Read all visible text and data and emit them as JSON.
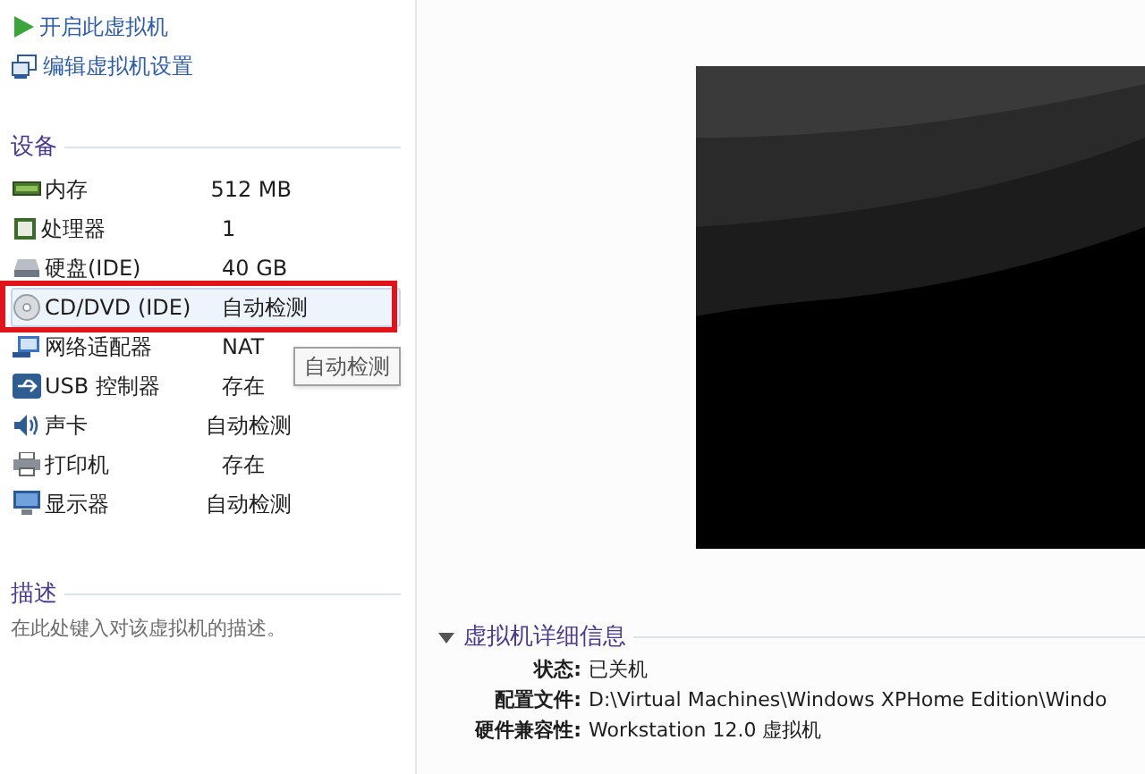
{
  "actions": [
    {
      "kind": "play",
      "label": "开启此虚拟机"
    },
    {
      "kind": "edit",
      "label": "编辑虚拟机设置"
    }
  ],
  "devices_section": {
    "title": "设备",
    "items": [
      {
        "kind": "memory",
        "name": "内存",
        "value": "512 MB",
        "selected": false
      },
      {
        "kind": "cpu",
        "name": "处理器",
        "value": "1",
        "selected": false
      },
      {
        "kind": "disk",
        "name": "硬盘(IDE)",
        "value": "40 GB",
        "selected": false
      },
      {
        "kind": "cd",
        "name": "CD/DVD (IDE)",
        "value": "自动检测",
        "selected": true
      },
      {
        "kind": "network",
        "name": "网络适配器",
        "value": "NAT",
        "selected": false
      },
      {
        "kind": "usb",
        "name": "USB 控制器",
        "value": "存在",
        "selected": false
      },
      {
        "kind": "sound",
        "name": "声卡",
        "value": "自动检测",
        "selected": false
      },
      {
        "kind": "printer",
        "name": "打印机",
        "value": "存在",
        "selected": false
      },
      {
        "kind": "display",
        "name": "显示器",
        "value": "自动检测",
        "selected": false
      }
    ]
  },
  "tooltip": "自动检测",
  "description_section": {
    "title": "描述",
    "placeholder": "在此处键入对该虚拟机的描述。"
  },
  "details_section": {
    "title": "虚拟机详细信息",
    "expanded": true,
    "rows": [
      {
        "label": "状态:",
        "value": "已关机"
      },
      {
        "label": "配置文件:",
        "value": "D:\\Virtual Machines\\Windows XPHome Edition\\Windo"
      },
      {
        "label": "硬件兼容性:",
        "value": "Workstation 12.0 虚拟机"
      }
    ]
  }
}
